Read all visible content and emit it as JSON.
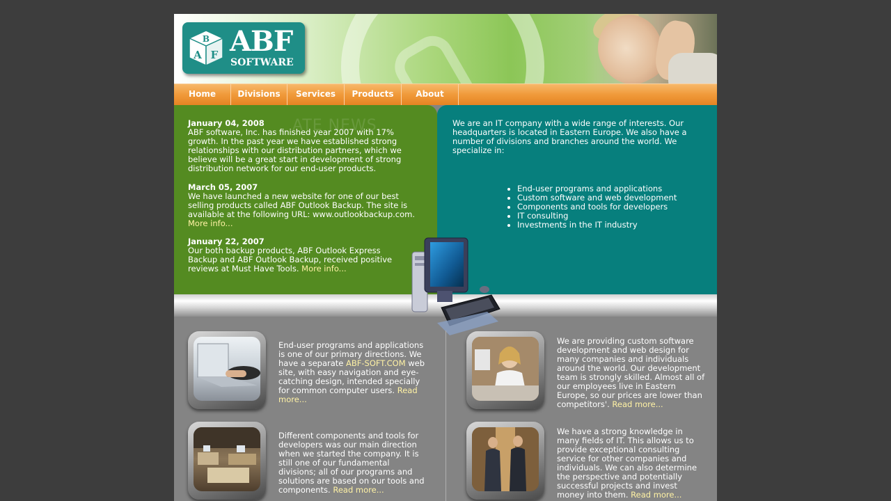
{
  "brand": {
    "line1": "ABF",
    "line2": "SOFTWARE",
    "cube_letters": [
      "A",
      "B",
      "F"
    ]
  },
  "nav": [
    "Home",
    "Divisions",
    "Services",
    "Products",
    "About"
  ],
  "news": {
    "watermark": "ATE NEWS",
    "items": [
      {
        "date": "January 04, 2008",
        "text": "ABF software, Inc. has finished year 2007 with 17% growth. In the past year we have established strong relationships with our distribution partners, which we believe will be a great start in development of strong distribution network for our end-user products.",
        "more": ""
      },
      {
        "date": "March 05, 2007",
        "text": "We have launched a new website for one of our best selling products called ABF Outlook Backup. The site is available at the following URL: www.outlookbackup.com.",
        "more": "More info..."
      },
      {
        "date": "January 22, 2007",
        "text": "Our both backup products, ABF Outlook Express Backup and ABF Outlook Backup, received positive reviews at Must Have Tools.",
        "more": "More info..."
      }
    ]
  },
  "about": {
    "intro": "We are an IT company with a wide range of interests. Our headquarters is located in Eastern Europe. We also have a number of divisions and branches around the world. We specialize in:",
    "list": [
      "End-user programs and applications",
      "Custom software and web development",
      "Components and tools for developers",
      "IT consulting",
      "Investments in the IT industry"
    ]
  },
  "blocks": [
    {
      "pre": "End-user programs and applications is one of our primary directions. We have a separate ",
      "link": "ABF-SOFT.COM",
      "post": " web site, with easy navigation and eye-catching design, intended specially for common computer users. ",
      "more": "Read more..."
    },
    {
      "pre": "We are providing custom software development and web design for many companies and individuals around the world. Our development team is strongly skilled. Almost all of our employees live in Eastern Europe, so our prices are lower than competitors'. ",
      "link": "",
      "post": "",
      "more": "Read more..."
    },
    {
      "pre": "Different components and tools for developers was our main direction when we started the company. It is still one of our fundamental divisions; all of our programs and solutions are based on our tools and components. ",
      "link": "",
      "post": "",
      "more": "Read more..."
    },
    {
      "pre": "We have a strong knowledge in many fields of IT. This allows us to provide exceptional consulting service for other companies and individuals. We can also determine the perspective and potentially successful projects and invest money into them. ",
      "link": "",
      "post": "",
      "more": "Read more..."
    }
  ],
  "colors": {
    "page_bg": "#3d3d3d",
    "news_green": "#548b21",
    "about_teal": "#077f7d",
    "nav_orange": "#f09a3a",
    "lower_gray": "#848484",
    "link_yellow": "#fff2a5"
  }
}
